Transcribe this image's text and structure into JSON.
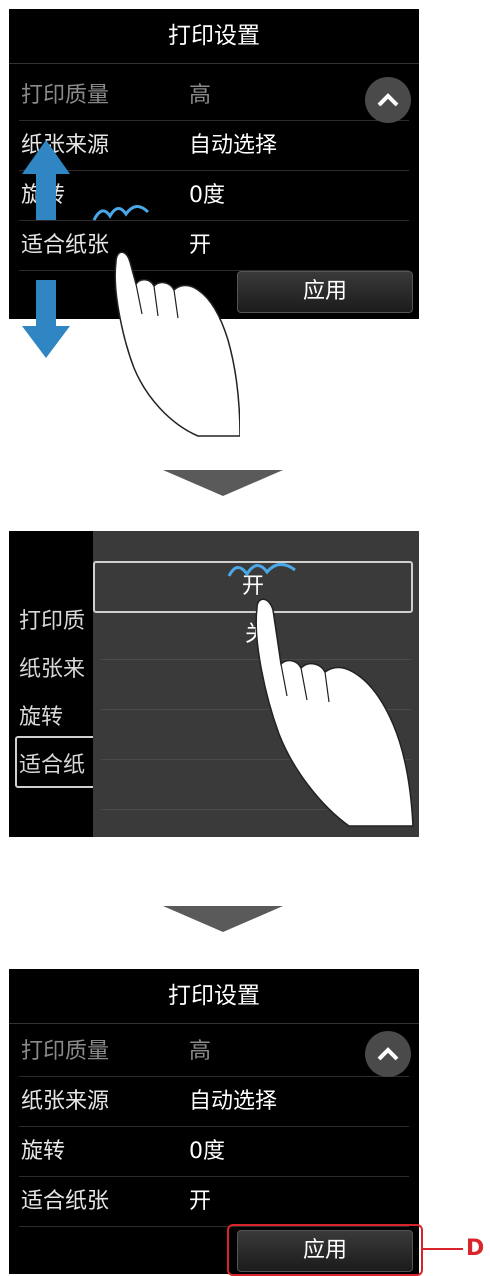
{
  "screen1": {
    "title": "打印设置",
    "rows": [
      {
        "label": "打印质量",
        "value": "高"
      },
      {
        "label": "纸张来源",
        "value": "自动选择"
      },
      {
        "label": "旋转",
        "value": "0度"
      },
      {
        "label": "适合纸张",
        "value": "开"
      }
    ],
    "scroll_up_icon": "chevron-up-icon",
    "apply_label": "应用"
  },
  "screen2": {
    "left_labels": [
      "打印质",
      "纸张来",
      "旋转",
      "适合纸"
    ],
    "options": [
      "开",
      "关"
    ]
  },
  "screen3": {
    "title": "打印设置",
    "rows": [
      {
        "label": "打印质量",
        "value": "高"
      },
      {
        "label": "纸张来源",
        "value": "自动选择"
      },
      {
        "label": "旋转",
        "value": "0度"
      },
      {
        "label": "适合纸张",
        "value": "开"
      }
    ],
    "scroll_up_icon": "chevron-up-icon",
    "apply_label": "应用"
  },
  "callout": {
    "letter": "D",
    "color": "#d8242a"
  },
  "colors": {
    "arrow_blue": "#2f86c3",
    "accent_line": "#4aa8e8"
  }
}
